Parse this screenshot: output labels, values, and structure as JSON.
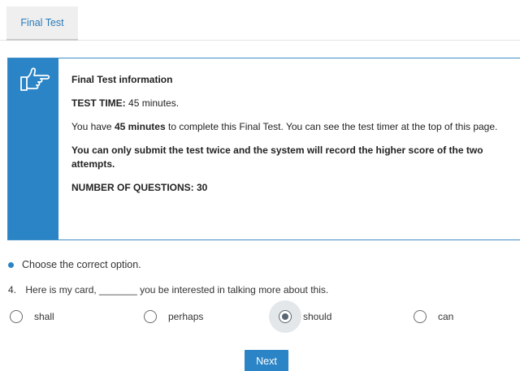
{
  "tabs": [
    {
      "label": "Final Test",
      "active": true
    }
  ],
  "info": {
    "title": "Final Test information",
    "test_time_label": "TEST TIME:",
    "test_time_value": "45 minutes.",
    "para1_a": "You have ",
    "para1_b": "45 minutes",
    "para1_c": " to complete this Final Test. You can see the test timer at the top of this page.",
    "para2": "You can only submit the test twice and the system will record the higher score of the two attempts.",
    "num_questions": "NUMBER OF QUESTIONS: 30"
  },
  "instruction": "Choose the correct option.",
  "question": {
    "number": "4.",
    "text": "Here is my card, _______ you be interested in talking more about this."
  },
  "options": [
    {
      "label": "shall",
      "selected": false
    },
    {
      "label": "perhaps",
      "selected": false
    },
    {
      "label": "should",
      "selected": true
    },
    {
      "label": "can",
      "selected": false
    }
  ],
  "next_label": "Next",
  "colors": {
    "accent": "#2a84c6",
    "link": "#2a7ab8"
  },
  "icons": {
    "info": "pointing-hand-icon"
  }
}
